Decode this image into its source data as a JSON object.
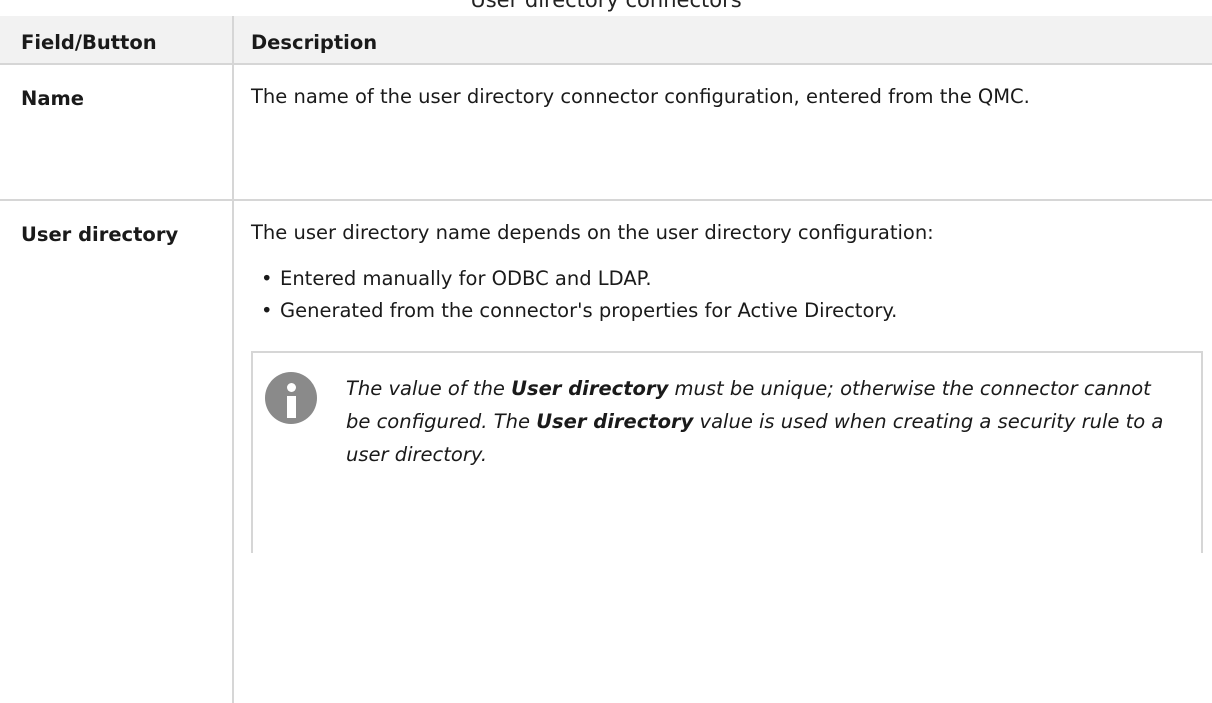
{
  "caption": "User directory connectors",
  "table": {
    "headers": [
      "Field/Button",
      "Description"
    ],
    "rows": [
      {
        "field": "Name",
        "description": "The name of the user directory connector configuration, entered from the QMC."
      },
      {
        "field": "User directory",
        "description": "The user directory name depends on the user directory configuration:",
        "bullets": [
          "Entered manually for ODBC and LDAP.",
          "Generated from the connector's properties for Active Directory."
        ],
        "note": {
          "icon": "info-icon",
          "part1": "The value of the ",
          "bold1": "User directory",
          "part2": " must be unique; otherwise the connector cannot be configured. The ",
          "bold2": "User directory",
          "part3": " value is used when creating a security rule to a user directory."
        }
      }
    ]
  },
  "colors": {
    "header_bg": "#f2f2f2",
    "border": "#d6d6d6",
    "icon": "#8a8a8a"
  }
}
